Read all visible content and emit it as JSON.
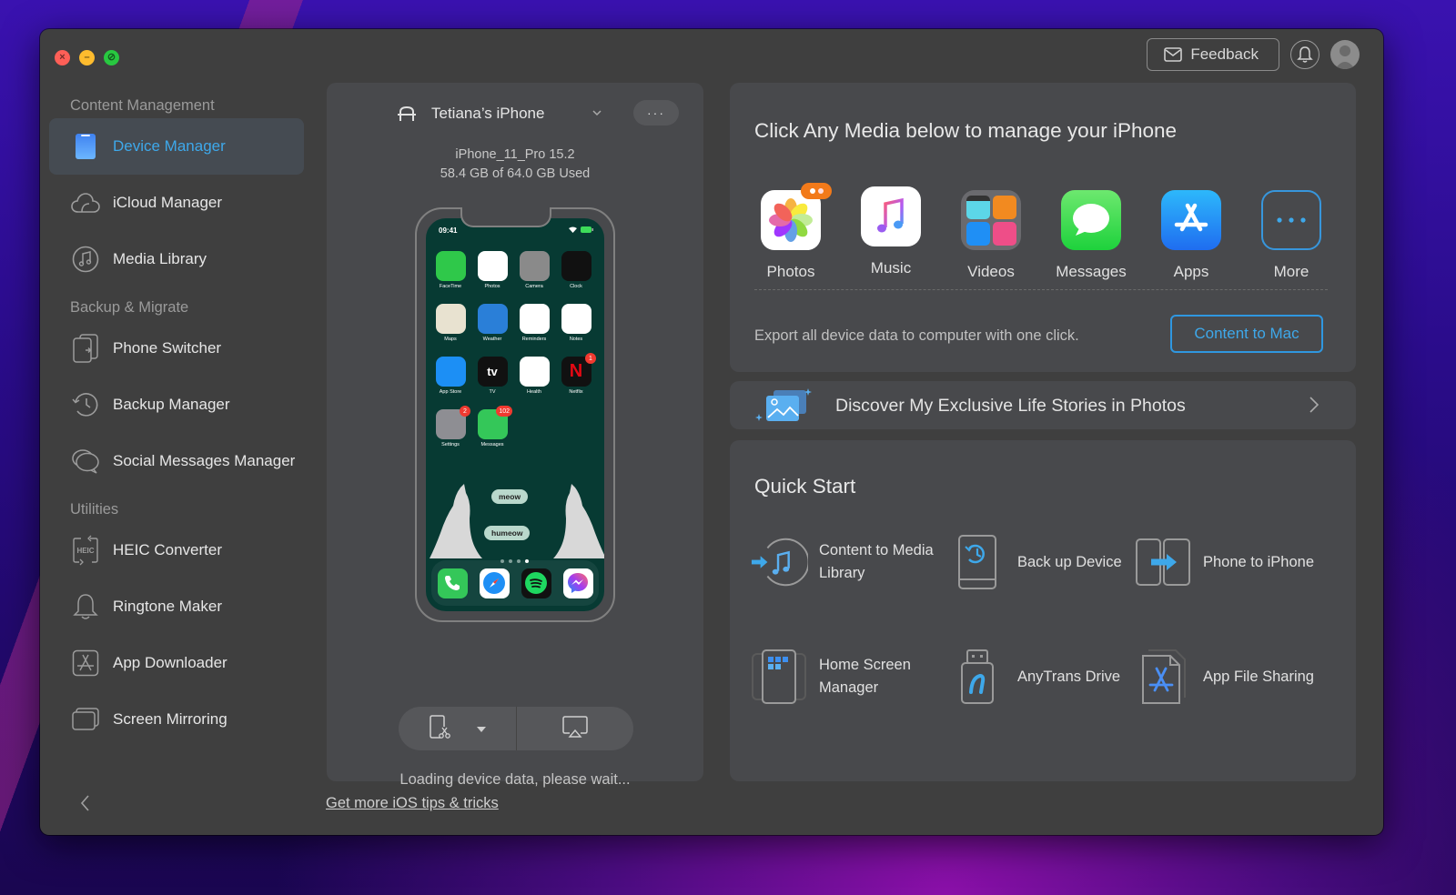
{
  "window": {
    "controls": [
      "close",
      "minimize",
      "zoom"
    ]
  },
  "header": {
    "feedback_label": "Feedback",
    "feedback_icon": "envelope-icon",
    "notification_icon": "bell-icon",
    "avatar_icon": "user-avatar-icon"
  },
  "sidebar": {
    "sections": [
      {
        "title": "Content Management",
        "items": [
          {
            "label": "Device Manager",
            "icon": "phone-icon",
            "active": true
          },
          {
            "label": "iCloud Manager",
            "icon": "cloud-icon"
          },
          {
            "label": "Media Library",
            "icon": "music-note-icon"
          }
        ]
      },
      {
        "title": "Backup & Migrate",
        "items": [
          {
            "label": "Phone Switcher",
            "icon": "phone-switch-icon"
          },
          {
            "label": "Backup Manager",
            "icon": "history-clock-icon"
          },
          {
            "label": "Social Messages Manager",
            "icon": "chat-bubbles-icon"
          }
        ]
      },
      {
        "title": "Utilities",
        "items": [
          {
            "label": "HEIC Converter",
            "icon": "heic-convert-icon",
            "icon_text": "HEIC"
          },
          {
            "label": "Ringtone Maker",
            "icon": "bell-icon"
          },
          {
            "label": "App Downloader",
            "icon": "app-store-icon"
          },
          {
            "label": "Screen Mirroring",
            "icon": "screens-icon"
          }
        ]
      }
    ],
    "collapse_icon": "chevron-left-icon"
  },
  "device": {
    "name": "Tetiana’s iPhone",
    "model": "iPhone_11_Pro 15.2",
    "storage": "58.4 GB of  64.0 GB Used",
    "more_label": "···",
    "screen": {
      "time": "09:41",
      "apps": [
        {
          "label": "FaceTime",
          "color": "#2fc84a"
        },
        {
          "label": "Photos",
          "color": "#ffffff"
        },
        {
          "label": "Camera",
          "color": "#8a8a8a"
        },
        {
          "label": "Clock",
          "color": "#111111"
        },
        {
          "label": "Maps",
          "color": "#e8e2d0"
        },
        {
          "label": "Weather",
          "color": "#2a7fd8"
        },
        {
          "label": "Reminders",
          "color": "#ffffff"
        },
        {
          "label": "Notes",
          "color": "#ffffff"
        },
        {
          "label": "App Store",
          "color": "#1c8ff5"
        },
        {
          "label": "TV",
          "color": "#111111",
          "glyph": "tv"
        },
        {
          "label": "Health",
          "color": "#ffffff"
        },
        {
          "label": "Netflix",
          "color": "#111111",
          "glyph": "N",
          "badge": "1"
        },
        {
          "label": "Settings",
          "color": "#8e8e93",
          "badge": "2"
        },
        {
          "label": "Messages",
          "color": "#34c759",
          "badge": "102"
        }
      ],
      "bubbles": [
        "meow",
        "humeow"
      ],
      "dock": [
        "Phone",
        "Safari",
        "Spotify",
        "Messenger"
      ]
    },
    "screenshot_icon": "screenshot-scissors-icon",
    "airplay_icon": "airplay-icon",
    "loading": "Loading device data, please wait..."
  },
  "tips_link": "Get more iOS tips & tricks",
  "media": {
    "title": "Click Any Media below to manage your iPhone",
    "items": [
      {
        "label": "Photos",
        "icon": "photos-icon"
      },
      {
        "label": "Music",
        "icon": "music-icon"
      },
      {
        "label": "Videos",
        "icon": "videos-icon"
      },
      {
        "label": "Messages",
        "icon": "messages-icon"
      },
      {
        "label": "Apps",
        "icon": "app-store-icon"
      },
      {
        "label": "More",
        "icon": "more-icon"
      }
    ],
    "export_text": "Export all device data to computer with one click.",
    "content_to_mac": "Content to Mac"
  },
  "discover": {
    "label": "Discover My Exclusive Life Stories in Photos"
  },
  "quick_start": {
    "title": "Quick Start",
    "items": [
      {
        "label": "Content to Media Library",
        "icon": "content-to-library-icon"
      },
      {
        "label": "Back up Device",
        "icon": "backup-device-icon"
      },
      {
        "label": "Phone to iPhone",
        "icon": "phone-to-phone-icon"
      },
      {
        "label": "Home Screen Manager",
        "icon": "home-screen-icon"
      },
      {
        "label": "AnyTrans Drive",
        "icon": "usb-drive-icon"
      },
      {
        "label": "App File Sharing",
        "icon": "app-file-icon"
      }
    ]
  },
  "colors": {
    "accent": "#3ea8ea",
    "window_bg": "#3f3f3f",
    "panel_bg": "#48494c"
  }
}
